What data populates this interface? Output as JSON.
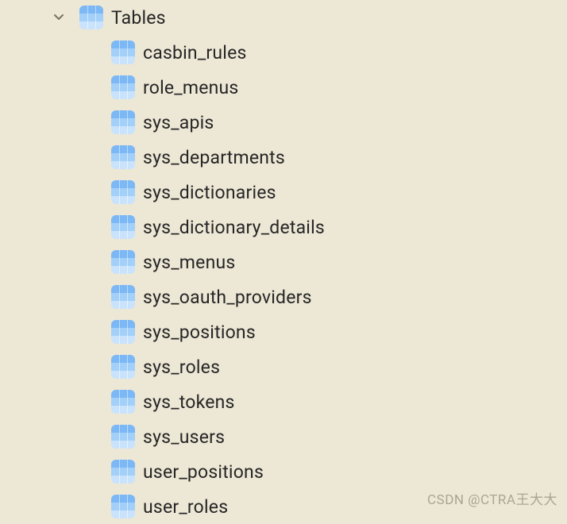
{
  "tree": {
    "parent_label": "Tables",
    "items": [
      {
        "label": "casbin_rules"
      },
      {
        "label": "role_menus"
      },
      {
        "label": "sys_apis"
      },
      {
        "label": "sys_departments"
      },
      {
        "label": "sys_dictionaries"
      },
      {
        "label": "sys_dictionary_details"
      },
      {
        "label": "sys_menus"
      },
      {
        "label": "sys_oauth_providers"
      },
      {
        "label": "sys_positions"
      },
      {
        "label": "sys_roles"
      },
      {
        "label": "sys_tokens"
      },
      {
        "label": "sys_users"
      },
      {
        "label": "user_positions"
      },
      {
        "label": "user_roles"
      }
    ]
  },
  "watermark": "CSDN @CTRA王大大"
}
